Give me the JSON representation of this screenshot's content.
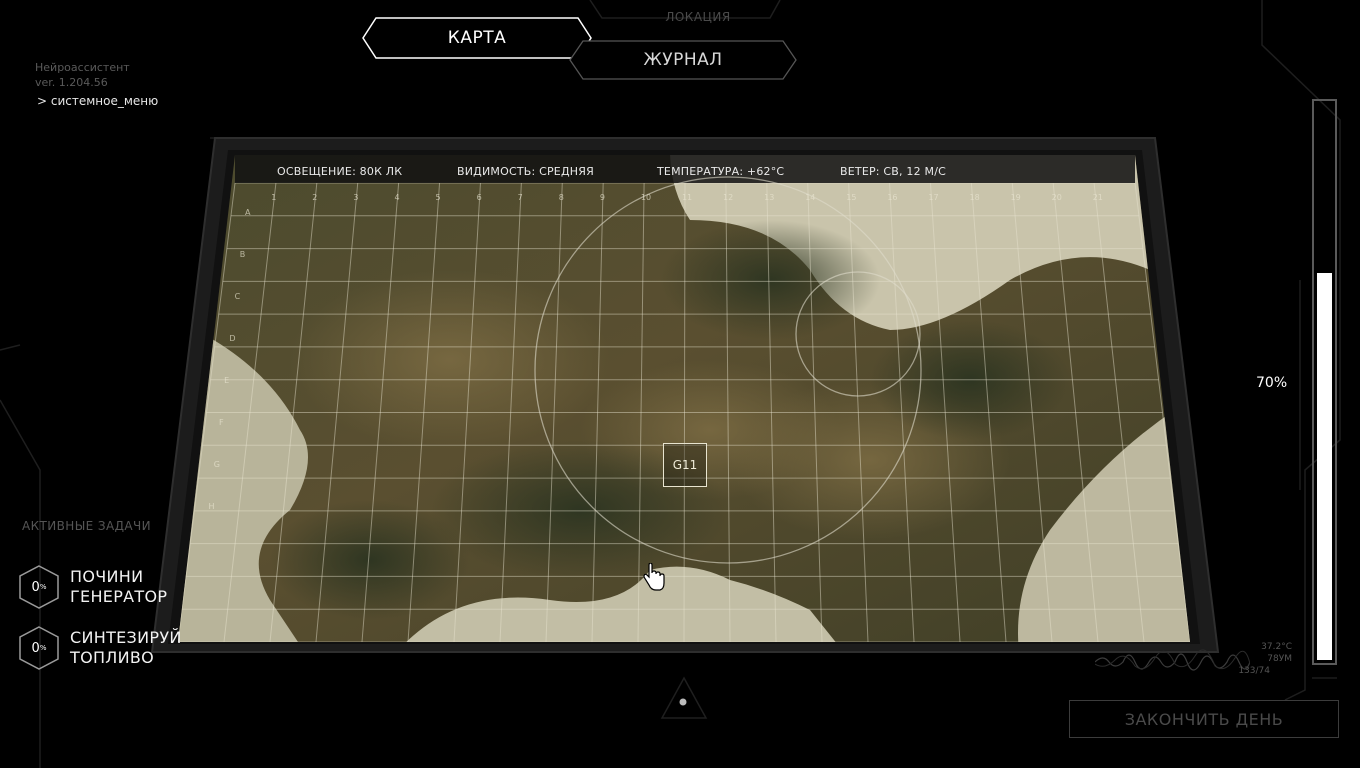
{
  "header": {
    "location_label": "ЛОКАЦИЯ",
    "tabs": [
      {
        "label": "КАРТА",
        "active": true
      },
      {
        "label": "ЖУРНАЛ",
        "active": false
      }
    ]
  },
  "system": {
    "name": "Нейроассистент",
    "version": "ver. 1.204.56",
    "menu_link": "> системное_меню"
  },
  "map": {
    "stats": {
      "lighting": "ОСВЕЩЕНИЕ: 80К ЛК",
      "visibility": "ВИДИМОСТЬ: СРЕДНЯЯ",
      "temperature": "ТЕМПЕРАТУРА: +62°С",
      "wind": "ВЕТЕР: СВ, 12 М/С"
    },
    "columns": [
      "1",
      "2",
      "3",
      "4",
      "5",
      "6",
      "7",
      "8",
      "9",
      "10",
      "11",
      "12",
      "13",
      "14",
      "15",
      "16",
      "17",
      "18",
      "19",
      "20",
      "21"
    ],
    "rows": [
      "A",
      "B",
      "C",
      "D",
      "E",
      "F",
      "G",
      "H"
    ],
    "selected_cell": "G11"
  },
  "tasks": {
    "title": "АКТИВНЫЕ ЗАДАЧИ",
    "items": [
      {
        "percent": "0",
        "percent_sign": "%",
        "line1": "ПОЧИНИ",
        "line2": "ГЕНЕРАТОР"
      },
      {
        "percent": "0",
        "percent_sign": "%",
        "line1": "СИНТЕЗИРУЙ",
        "line2": "ТОПЛИВО"
      }
    ]
  },
  "gauge": {
    "label": "70%",
    "level": 0.7
  },
  "vitals": {
    "temp": "37.2°C",
    "pulse": "78УМ",
    "pressure": "133/74"
  },
  "end_day_label": "ЗАКОНЧИТЬ ДЕНЬ",
  "colors": {
    "background": "#000000",
    "accent": "#ffffff",
    "dim": "#4a4a4a"
  }
}
